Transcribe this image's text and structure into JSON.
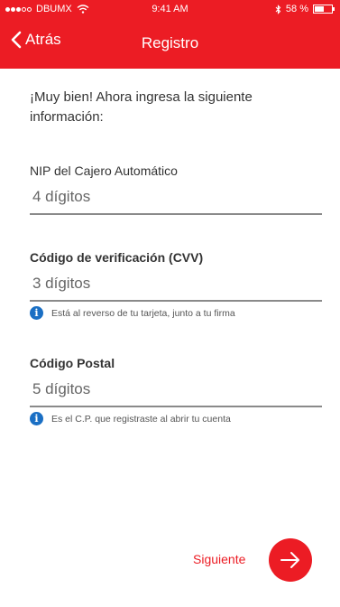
{
  "status_bar": {
    "carrier": "DBUMX",
    "time": "9:41 AM",
    "battery": "58 %",
    "battery_level": 0.58,
    "signal_bars_filled": 3,
    "signal_bars_total": 5,
    "icons": [
      "wifi-icon",
      "bluetooth-icon",
      "battery-icon"
    ]
  },
  "nav": {
    "back_label": "Atrás",
    "title": "Registro"
  },
  "intro_text": "¡Muy bien! Ahora ingresa la siguiente información:",
  "fields": [
    {
      "label": "NIP del Cajero Automático",
      "placeholder": "4 dígitos",
      "value": ""
    },
    {
      "label": "Código de verificación (CVV)",
      "placeholder": "3 dígitos",
      "value": "",
      "hint": "Está al reverso de tu tarjeta, junto a tu firma"
    },
    {
      "label": "Código Postal",
      "placeholder": "5 dígitos",
      "value": "",
      "hint": "Es el C.P. que registraste al abrir tu cuenta"
    }
  ],
  "next": {
    "label": "Siguiente",
    "icon": "arrow-right-icon"
  },
  "colors": {
    "brand_red": "#ec1c24",
    "info_blue": "#1a6fc4",
    "underline": "#8a8a8a"
  }
}
